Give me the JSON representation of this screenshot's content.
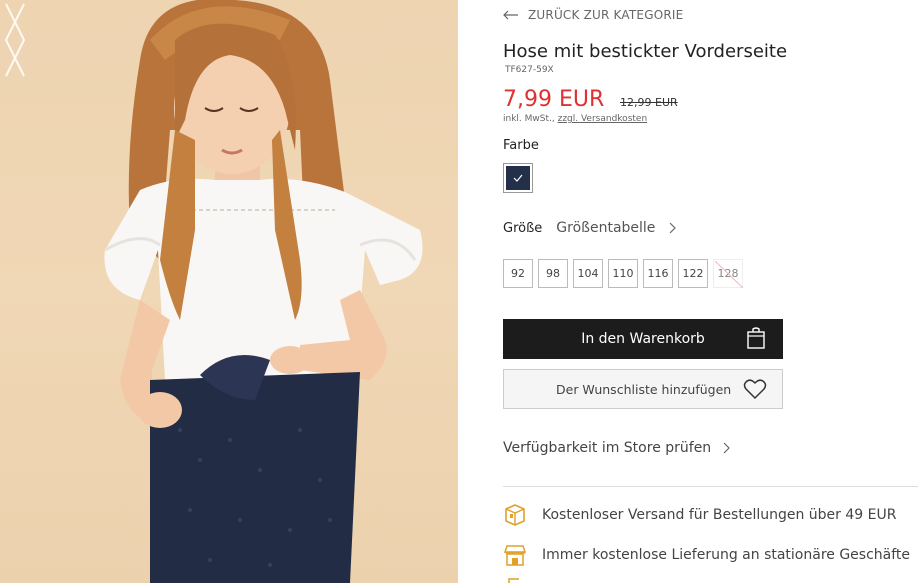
{
  "gallery": {
    "prev_icon": "chevron-left-icon",
    "next_icon": "chevron-right-icon",
    "image": "product-photo-girl-white-blouse-navy-trousers"
  },
  "nav": {
    "back_label": "ZURÜCK ZUR KATEGORIE",
    "back_icon": "arrow-left-icon"
  },
  "product": {
    "title": "Hose mit bestickter Vorderseite",
    "sku": "TF627-59X",
    "price": "7,99 EUR",
    "old_price": "12,99 EUR",
    "tax_text": "inkl. MwSt., ",
    "shipping_link": "zzgl. Versandkosten",
    "price_color": "#e03131"
  },
  "color": {
    "label": "Farbe",
    "selected_swatch": "#233049",
    "check_icon": "check-icon"
  },
  "size": {
    "label": "Größe",
    "chart_link": "Größentabelle",
    "options": [
      {
        "label": "92",
        "available": true
      },
      {
        "label": "98",
        "available": true
      },
      {
        "label": "104",
        "available": true
      },
      {
        "label": "110",
        "available": true
      },
      {
        "label": "116",
        "available": true
      },
      {
        "label": "122",
        "available": true
      },
      {
        "label": "128",
        "available": false
      }
    ]
  },
  "actions": {
    "cart_label": "In den Warenkorb",
    "cart_icon": "shopping-bag-icon",
    "wishlist_label": "Der Wunschliste hinzufügen",
    "wishlist_icon": "heart-icon"
  },
  "store": {
    "label": "Verfügbarkeit im Store prüfen"
  },
  "perks": [
    {
      "icon": "delivery-box-icon",
      "text": "Kostenloser Versand für Bestellungen über 49 EUR"
    },
    {
      "icon": "store-icon",
      "text": "Immer kostenlose Lieferung an stationäre Geschäfte"
    }
  ],
  "accent_icon_color": "#e0a02a"
}
